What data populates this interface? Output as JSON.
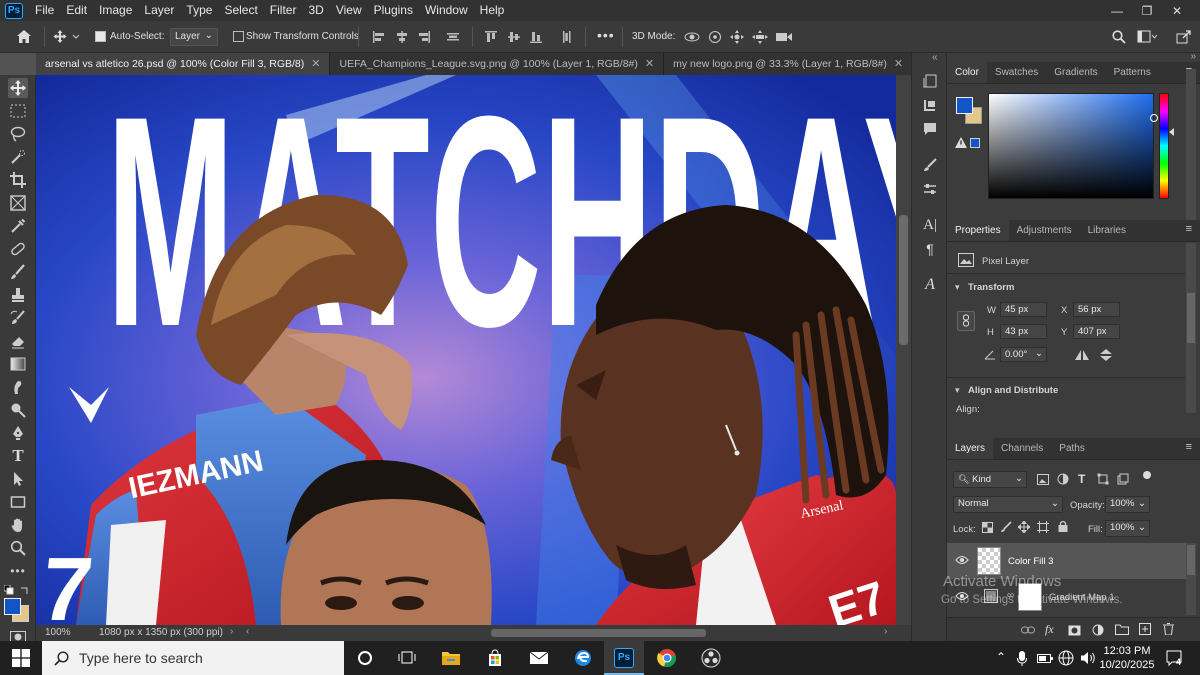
{
  "app": {
    "logo_text": "Ps"
  },
  "menu": [
    "File",
    "Edit",
    "Image",
    "Layer",
    "Type",
    "Select",
    "Filter",
    "3D",
    "View",
    "Plugins",
    "Window",
    "Help"
  ],
  "options_bar": {
    "auto_select_label": "Auto-Select:",
    "auto_select_checked": true,
    "layer_target": "Layer",
    "show_transform_label": "Show Transform Controls",
    "show_transform_checked": false,
    "mode_3d_label": "3D Mode:"
  },
  "tabs": [
    {
      "label": "arsenal vs atletico 26.psd @ 100% (Color Fill 3, RGB/8)",
      "active": true
    },
    {
      "label": "UEFA_Champions_League.svg.png @ 100% (Layer 1, RGB/8#)",
      "active": false
    },
    {
      "label": "my new logo.png @ 33.3% (Layer 1, RGB/8#)",
      "active": false
    }
  ],
  "canvas": {
    "headline": "MATCHDAY",
    "jersey_name_left": "IEZMANN",
    "jersey_number_left": "7",
    "jersey_text_right": "E7",
    "sponsor_text": "Arsenal"
  },
  "status_bar": {
    "zoom": "100%",
    "doc_info": "1080 px x 1350 px (300 ppi)"
  },
  "color_panel": {
    "tabs": [
      "Color",
      "Swatches",
      "Gradients",
      "Patterns"
    ],
    "active_tab": "Color",
    "foreground": "#1255c8",
    "background": "#e3c78b"
  },
  "properties_panel": {
    "tabs": [
      "Properties",
      "Adjustments",
      "Libraries"
    ],
    "active_tab": "Properties",
    "layer_kind": "Pixel Layer",
    "transform_label": "Transform",
    "w_label": "W",
    "w": "45 px",
    "h_label": "H",
    "h": "43 px",
    "x_label": "X",
    "x": "56 px",
    "y_label": "Y",
    "y": "407 px",
    "angle": "0.00°",
    "align_label": "Align and Distribute",
    "align_sub": "Align:"
  },
  "layers_panel": {
    "tabs": [
      "Layers",
      "Channels",
      "Paths"
    ],
    "active_tab": "Layers",
    "filter_kind": "Kind",
    "blend_mode": "Normal",
    "opacity_label": "Opacity:",
    "opacity": "100%",
    "lock_label": "Lock:",
    "fill_label": "Fill:",
    "fill": "100%",
    "layers": [
      {
        "name": "Color Fill 3",
        "selected": true
      },
      {
        "name": "Gradient Map 1",
        "selected": false
      }
    ]
  },
  "watermark": {
    "line1": "Activate Windows",
    "line2": "Go to Settings to activate Windows."
  },
  "taskbar": {
    "search_placeholder": "Type here to search",
    "time": "12:03 PM",
    "date": "10/20/2025",
    "notification_count": "4"
  }
}
